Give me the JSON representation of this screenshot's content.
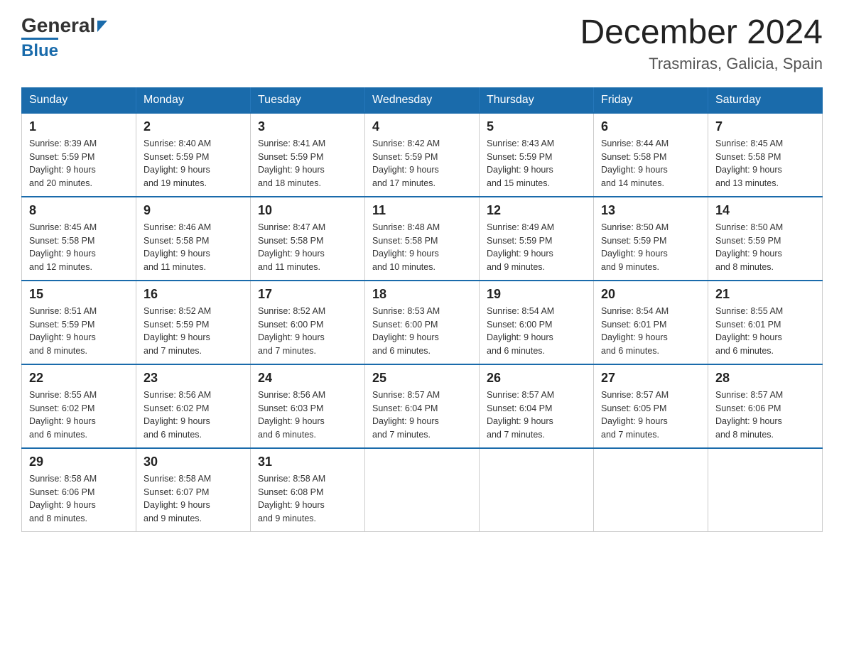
{
  "logo": {
    "general": "General",
    "blue": "Blue",
    "triangle_color": "#1a6bab"
  },
  "title": "December 2024",
  "subtitle": "Trasmiras, Galicia, Spain",
  "weekdays": [
    "Sunday",
    "Monday",
    "Tuesday",
    "Wednesday",
    "Thursday",
    "Friday",
    "Saturday"
  ],
  "weeks": [
    [
      {
        "day": "1",
        "sunrise": "8:39 AM",
        "sunset": "5:59 PM",
        "daylight": "9 hours and 20 minutes."
      },
      {
        "day": "2",
        "sunrise": "8:40 AM",
        "sunset": "5:59 PM",
        "daylight": "9 hours and 19 minutes."
      },
      {
        "day": "3",
        "sunrise": "8:41 AM",
        "sunset": "5:59 PM",
        "daylight": "9 hours and 18 minutes."
      },
      {
        "day": "4",
        "sunrise": "8:42 AM",
        "sunset": "5:59 PM",
        "daylight": "9 hours and 17 minutes."
      },
      {
        "day": "5",
        "sunrise": "8:43 AM",
        "sunset": "5:59 PM",
        "daylight": "9 hours and 15 minutes."
      },
      {
        "day": "6",
        "sunrise": "8:44 AM",
        "sunset": "5:58 PM",
        "daylight": "9 hours and 14 minutes."
      },
      {
        "day": "7",
        "sunrise": "8:45 AM",
        "sunset": "5:58 PM",
        "daylight": "9 hours and 13 minutes."
      }
    ],
    [
      {
        "day": "8",
        "sunrise": "8:45 AM",
        "sunset": "5:58 PM",
        "daylight": "9 hours and 12 minutes."
      },
      {
        "day": "9",
        "sunrise": "8:46 AM",
        "sunset": "5:58 PM",
        "daylight": "9 hours and 11 minutes."
      },
      {
        "day": "10",
        "sunrise": "8:47 AM",
        "sunset": "5:58 PM",
        "daylight": "9 hours and 11 minutes."
      },
      {
        "day": "11",
        "sunrise": "8:48 AM",
        "sunset": "5:58 PM",
        "daylight": "9 hours and 10 minutes."
      },
      {
        "day": "12",
        "sunrise": "8:49 AM",
        "sunset": "5:59 PM",
        "daylight": "9 hours and 9 minutes."
      },
      {
        "day": "13",
        "sunrise": "8:50 AM",
        "sunset": "5:59 PM",
        "daylight": "9 hours and 9 minutes."
      },
      {
        "day": "14",
        "sunrise": "8:50 AM",
        "sunset": "5:59 PM",
        "daylight": "9 hours and 8 minutes."
      }
    ],
    [
      {
        "day": "15",
        "sunrise": "8:51 AM",
        "sunset": "5:59 PM",
        "daylight": "9 hours and 8 minutes."
      },
      {
        "day": "16",
        "sunrise": "8:52 AM",
        "sunset": "5:59 PM",
        "daylight": "9 hours and 7 minutes."
      },
      {
        "day": "17",
        "sunrise": "8:52 AM",
        "sunset": "6:00 PM",
        "daylight": "9 hours and 7 minutes."
      },
      {
        "day": "18",
        "sunrise": "8:53 AM",
        "sunset": "6:00 PM",
        "daylight": "9 hours and 6 minutes."
      },
      {
        "day": "19",
        "sunrise": "8:54 AM",
        "sunset": "6:00 PM",
        "daylight": "9 hours and 6 minutes."
      },
      {
        "day": "20",
        "sunrise": "8:54 AM",
        "sunset": "6:01 PM",
        "daylight": "9 hours and 6 minutes."
      },
      {
        "day": "21",
        "sunrise": "8:55 AM",
        "sunset": "6:01 PM",
        "daylight": "9 hours and 6 minutes."
      }
    ],
    [
      {
        "day": "22",
        "sunrise": "8:55 AM",
        "sunset": "6:02 PM",
        "daylight": "9 hours and 6 minutes."
      },
      {
        "day": "23",
        "sunrise": "8:56 AM",
        "sunset": "6:02 PM",
        "daylight": "9 hours and 6 minutes."
      },
      {
        "day": "24",
        "sunrise": "8:56 AM",
        "sunset": "6:03 PM",
        "daylight": "9 hours and 6 minutes."
      },
      {
        "day": "25",
        "sunrise": "8:57 AM",
        "sunset": "6:04 PM",
        "daylight": "9 hours and 7 minutes."
      },
      {
        "day": "26",
        "sunrise": "8:57 AM",
        "sunset": "6:04 PM",
        "daylight": "9 hours and 7 minutes."
      },
      {
        "day": "27",
        "sunrise": "8:57 AM",
        "sunset": "6:05 PM",
        "daylight": "9 hours and 7 minutes."
      },
      {
        "day": "28",
        "sunrise": "8:57 AM",
        "sunset": "6:06 PM",
        "daylight": "9 hours and 8 minutes."
      }
    ],
    [
      {
        "day": "29",
        "sunrise": "8:58 AM",
        "sunset": "6:06 PM",
        "daylight": "9 hours and 8 minutes."
      },
      {
        "day": "30",
        "sunrise": "8:58 AM",
        "sunset": "6:07 PM",
        "daylight": "9 hours and 9 minutes."
      },
      {
        "day": "31",
        "sunrise": "8:58 AM",
        "sunset": "6:08 PM",
        "daylight": "9 hours and 9 minutes."
      },
      null,
      null,
      null,
      null
    ]
  ],
  "labels": {
    "sunrise": "Sunrise:",
    "sunset": "Sunset:",
    "daylight": "Daylight:"
  }
}
